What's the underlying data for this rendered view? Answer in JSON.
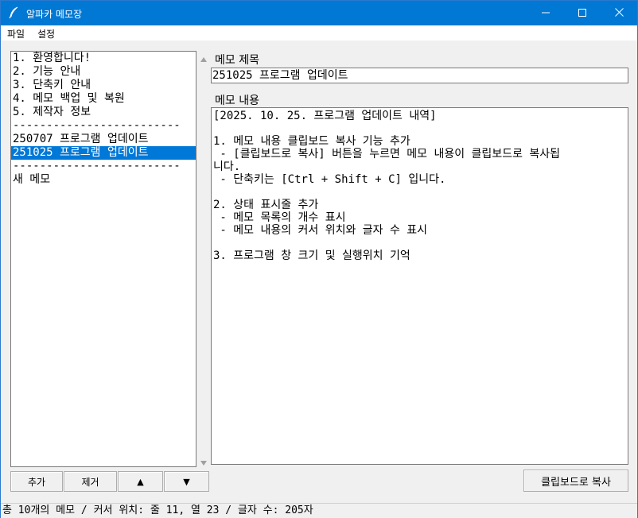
{
  "window": {
    "title": "알파카 메모장"
  },
  "menu": {
    "file": "파일",
    "settings": "설정"
  },
  "memo_list": {
    "items": [
      "1. 환영합니다!",
      "2. 기능 안내",
      "3. 단축키 안내",
      "4. 메모 백업 및 복원",
      "5. 제작자 정보",
      "-------------------------",
      "250707 프로그램 업데이트",
      "251025 프로그램 업데이트",
      "-------------------------",
      "새 메모"
    ],
    "selected_index": 7
  },
  "buttons": {
    "add": "추가",
    "remove": "제거",
    "up": "▲",
    "down": "▼",
    "copy": "클립보드로 복사"
  },
  "memo": {
    "title_label": "메모 제목",
    "title_value": "251025 프로그램 업데이트",
    "content_label": "메모 내용",
    "content_lines": [
      "[2025. 10. 25. 프로그램 업데이트 내역]",
      "",
      "1. 메모 내용 클립보드 복사 기능 추가",
      " - [클립보드로 복사] 버튼을 누르면 메모 내용이 클립보드로 복사됩",
      "니다.",
      " - 단축키는 [Ctrl + Shift + C] 입니다.",
      "",
      "2. 상태 표시줄 추가",
      " - 메모 목록의 개수 표시",
      " - 메모 내용의 커서 위치와 글자 수 표시",
      "",
      "3. 프로그램 창 크기 및 실행위치 기억"
    ]
  },
  "status": {
    "text": "총 10개의 메모 / 커서 위치: 줄 11, 열 23 / 글자 수: 205자"
  },
  "icons": {
    "app": "feather-pen-icon",
    "minimize": "minimize-icon",
    "maximize": "maximize-icon",
    "close": "close-icon"
  },
  "colors": {
    "titlebar": "#0078d4",
    "selection": "#0078d7"
  }
}
